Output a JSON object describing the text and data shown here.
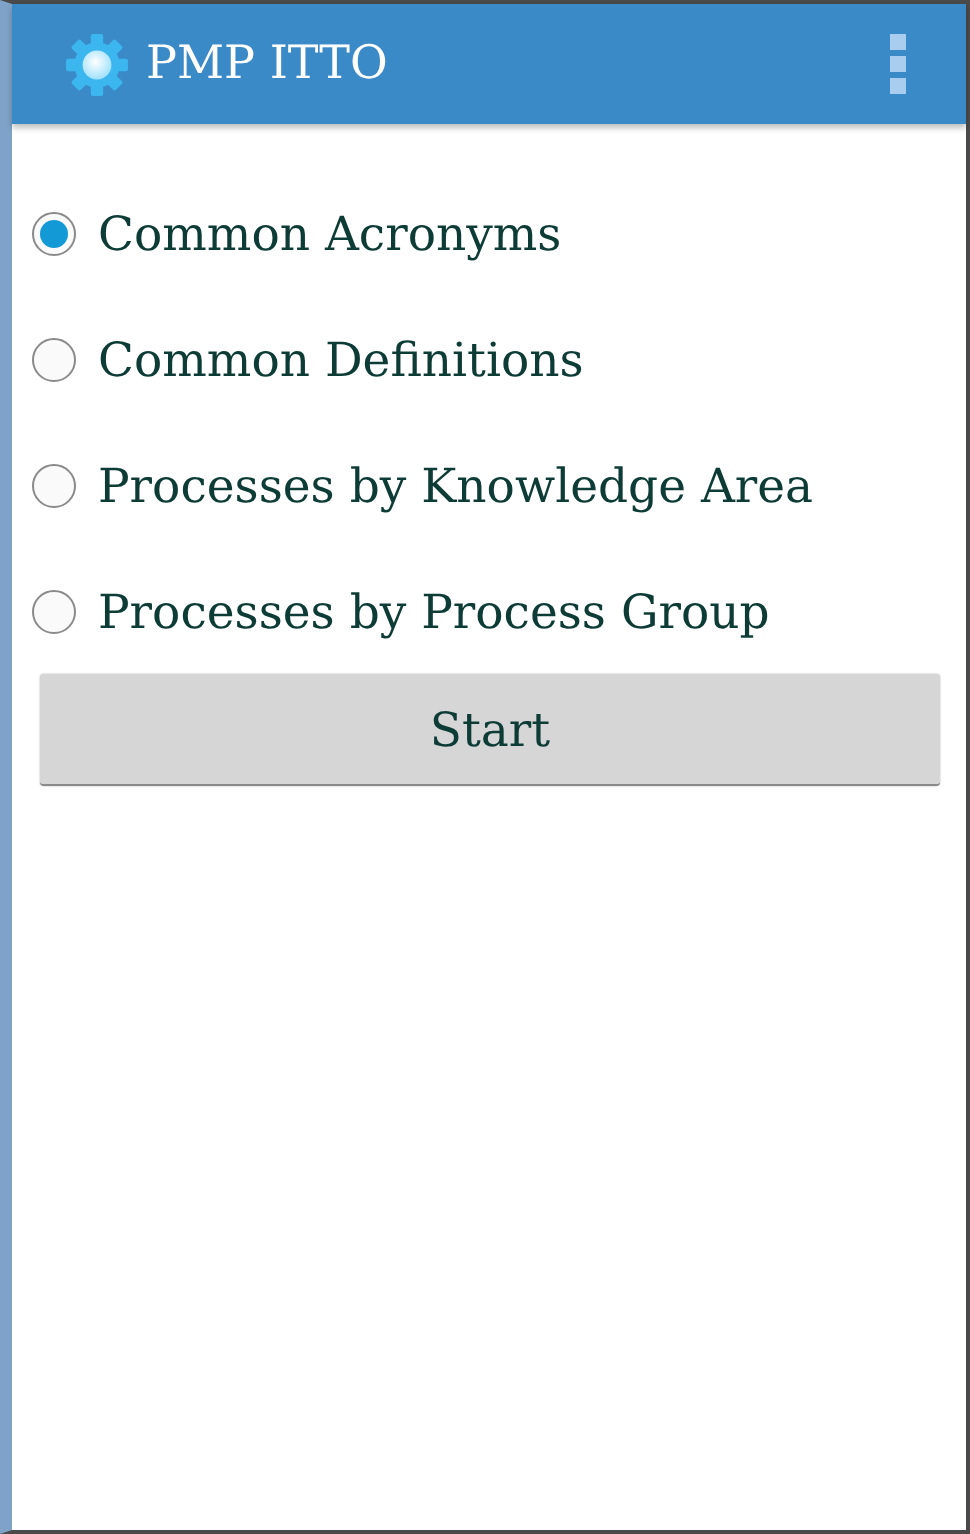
{
  "action_bar": {
    "title": "PMP ITTO"
  },
  "options": [
    {
      "label": "Common Acronyms",
      "selected": true
    },
    {
      "label": "Common Definitions",
      "selected": false
    },
    {
      "label": "Processes by Knowledge Area",
      "selected": false
    },
    {
      "label": "Processes by Process Group",
      "selected": false
    }
  ],
  "start_button": {
    "label": "Start"
  }
}
